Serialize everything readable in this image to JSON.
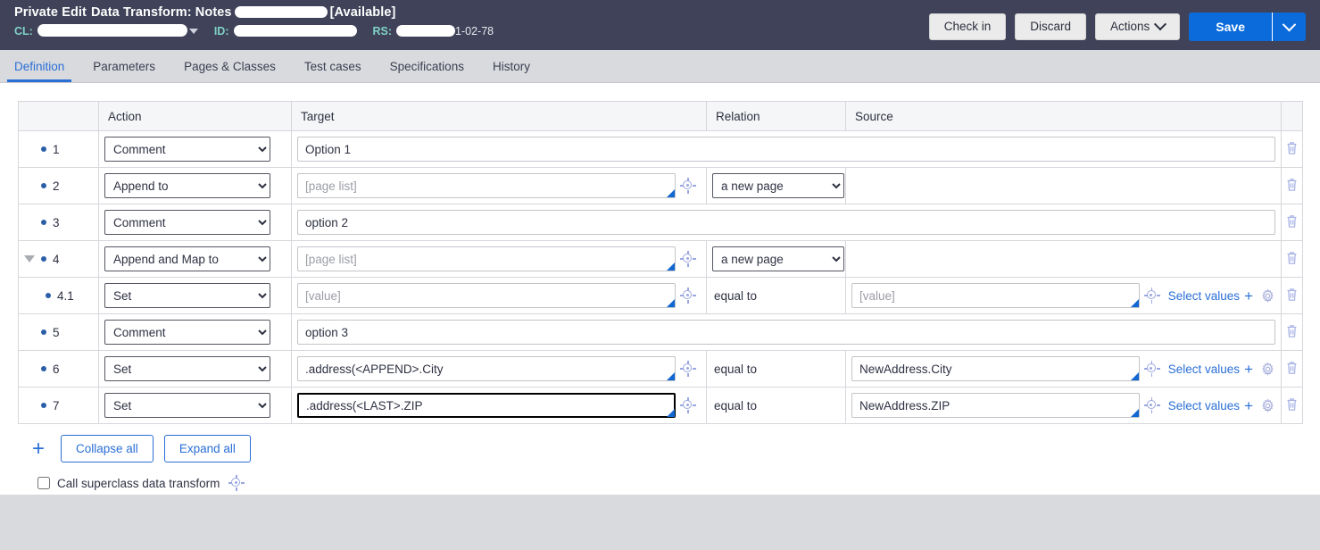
{
  "header": {
    "title_prefix": "Private Edit",
    "title_main": "Data Transform: Notes",
    "title_redacted": "",
    "title_suffix": "[Available]",
    "cl_label": "CL:",
    "cl_value": "",
    "id_label": "ID:",
    "id_value": "",
    "rs_label": "RS:",
    "rs_value": "1-02-78",
    "buttons": {
      "check_in": "Check in",
      "discard": "Discard",
      "actions": "Actions",
      "save": "Save"
    },
    "bg_color": "#3f4258",
    "save_color": "#0b6bdb",
    "accent_teal": "#7fd2c8"
  },
  "tabs": [
    {
      "label": "Definition",
      "active": true
    },
    {
      "label": "Parameters",
      "active": false
    },
    {
      "label": "Pages & Classes",
      "active": false
    },
    {
      "label": "Test cases",
      "active": false
    },
    {
      "label": "Specifications",
      "active": false
    },
    {
      "label": "History",
      "active": false
    }
  ],
  "table": {
    "columns": [
      "",
      "Action",
      "Target",
      "Relation",
      "Source",
      ""
    ],
    "rows": [
      {
        "number": "1",
        "indent": false,
        "has_toggle": false,
        "action": "Comment",
        "target_value": "Option 1",
        "target_placeholder": "",
        "target_span_full": true,
        "target_has_corner": false,
        "target_focused": false,
        "target_has_crosshair": false,
        "relation_type": "none",
        "relation_value": "",
        "source_type": "none",
        "source_value": "",
        "source_placeholder": ""
      },
      {
        "number": "2",
        "indent": false,
        "has_toggle": false,
        "action": "Append to",
        "target_value": "",
        "target_placeholder": "[page list]",
        "target_span_full": false,
        "target_has_corner": true,
        "target_focused": false,
        "target_has_crosshair": true,
        "relation_type": "select",
        "relation_value": "a new page",
        "source_type": "empty",
        "source_value": "",
        "source_placeholder": ""
      },
      {
        "number": "3",
        "indent": false,
        "has_toggle": false,
        "action": "Comment",
        "target_value": "option 2",
        "target_placeholder": "",
        "target_span_full": true,
        "target_has_corner": false,
        "target_focused": false,
        "target_has_crosshair": false,
        "relation_type": "none",
        "relation_value": "",
        "source_type": "none",
        "source_value": "",
        "source_placeholder": ""
      },
      {
        "number": "4",
        "indent": false,
        "has_toggle": true,
        "action": "Append and Map to",
        "target_value": "",
        "target_placeholder": "[page list]",
        "target_span_full": false,
        "target_has_corner": true,
        "target_focused": false,
        "target_has_crosshair": true,
        "relation_type": "select",
        "relation_value": "a new page",
        "source_type": "empty",
        "source_value": "",
        "source_placeholder": ""
      },
      {
        "number": "4.1",
        "indent": true,
        "has_toggle": false,
        "action": "Set",
        "target_value": "",
        "target_placeholder": "[value]",
        "target_span_full": false,
        "target_has_corner": true,
        "target_focused": false,
        "target_has_crosshair": true,
        "relation_type": "text",
        "relation_value": "equal to",
        "source_type": "input",
        "source_value": "",
        "source_placeholder": "[value]"
      },
      {
        "number": "5",
        "indent": false,
        "has_toggle": false,
        "action": "Comment",
        "target_value": "option 3",
        "target_placeholder": "",
        "target_span_full": true,
        "target_has_corner": false,
        "target_focused": false,
        "target_has_crosshair": false,
        "relation_type": "none",
        "relation_value": "",
        "source_type": "none",
        "source_value": "",
        "source_placeholder": ""
      },
      {
        "number": "6",
        "indent": false,
        "has_toggle": false,
        "action": "Set",
        "target_value": ".address(<APPEND>.City",
        "target_placeholder": "",
        "target_span_full": false,
        "target_has_corner": true,
        "target_focused": false,
        "target_has_crosshair": true,
        "relation_type": "text",
        "relation_value": "equal to",
        "source_type": "input",
        "source_value": "NewAddress.City",
        "source_placeholder": ""
      },
      {
        "number": "7",
        "indent": false,
        "has_toggle": false,
        "action": "Set",
        "target_value": ".address(<LAST>.ZIP",
        "target_placeholder": "",
        "target_span_full": false,
        "target_has_corner": true,
        "target_focused": true,
        "target_has_crosshair": true,
        "relation_type": "text",
        "relation_value": "equal to",
        "source_type": "input",
        "source_value": "NewAddress.ZIP",
        "source_placeholder": ""
      }
    ],
    "select_values_label": "Select values",
    "plus_label": "+"
  },
  "bottom": {
    "add_label": "+",
    "collapse_all": "Collapse all",
    "expand_all": "Expand all",
    "superclass_label": "Call superclass data transform",
    "superclass_checked": false
  },
  "colors": {
    "link": "#2a6fd6",
    "page_bg": "#d9dade",
    "panel_bg": "#ffffff",
    "border": "#d6d7db"
  }
}
